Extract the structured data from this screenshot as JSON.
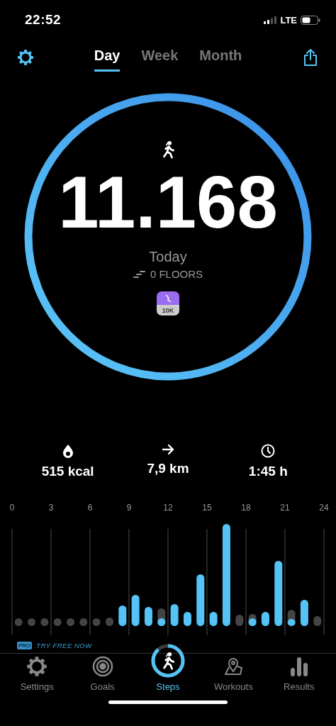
{
  "status_bar": {
    "time": "22:52",
    "network": "LTE"
  },
  "top_bar": {
    "tabs": [
      {
        "label": "Day",
        "selected": true
      },
      {
        "label": "Week",
        "selected": false
      },
      {
        "label": "Month",
        "selected": false
      }
    ]
  },
  "ring": {
    "level": 1,
    "steps": "11.168",
    "period": "Today",
    "floors": "0 FLOORS",
    "badge": "10K"
  },
  "stats": [
    {
      "kind": "calories",
      "value": "515 kcal"
    },
    {
      "kind": "distance",
      "value": "7,9 km"
    },
    {
      "kind": "duration",
      "value": "1:45 h"
    }
  ],
  "hourly_chart": {
    "hours": [
      "0",
      "3",
      "6",
      "9",
      "12",
      "15",
      "18",
      "21",
      "24"
    ]
  },
  "promo": {
    "badge": "PRO",
    "text": "TRY FREE NOW"
  },
  "tab_bar": {
    "items": [
      {
        "kind": "settings",
        "label": "Settings",
        "selected": false
      },
      {
        "kind": "goals",
        "label": "Goals",
        "selected": false
      },
      {
        "kind": "steps",
        "label": "Steps",
        "selected": true
      },
      {
        "kind": "workouts",
        "label": "Workouts",
        "selected": false
      },
      {
        "kind": "results",
        "label": "Results",
        "selected": false
      }
    ]
  }
}
